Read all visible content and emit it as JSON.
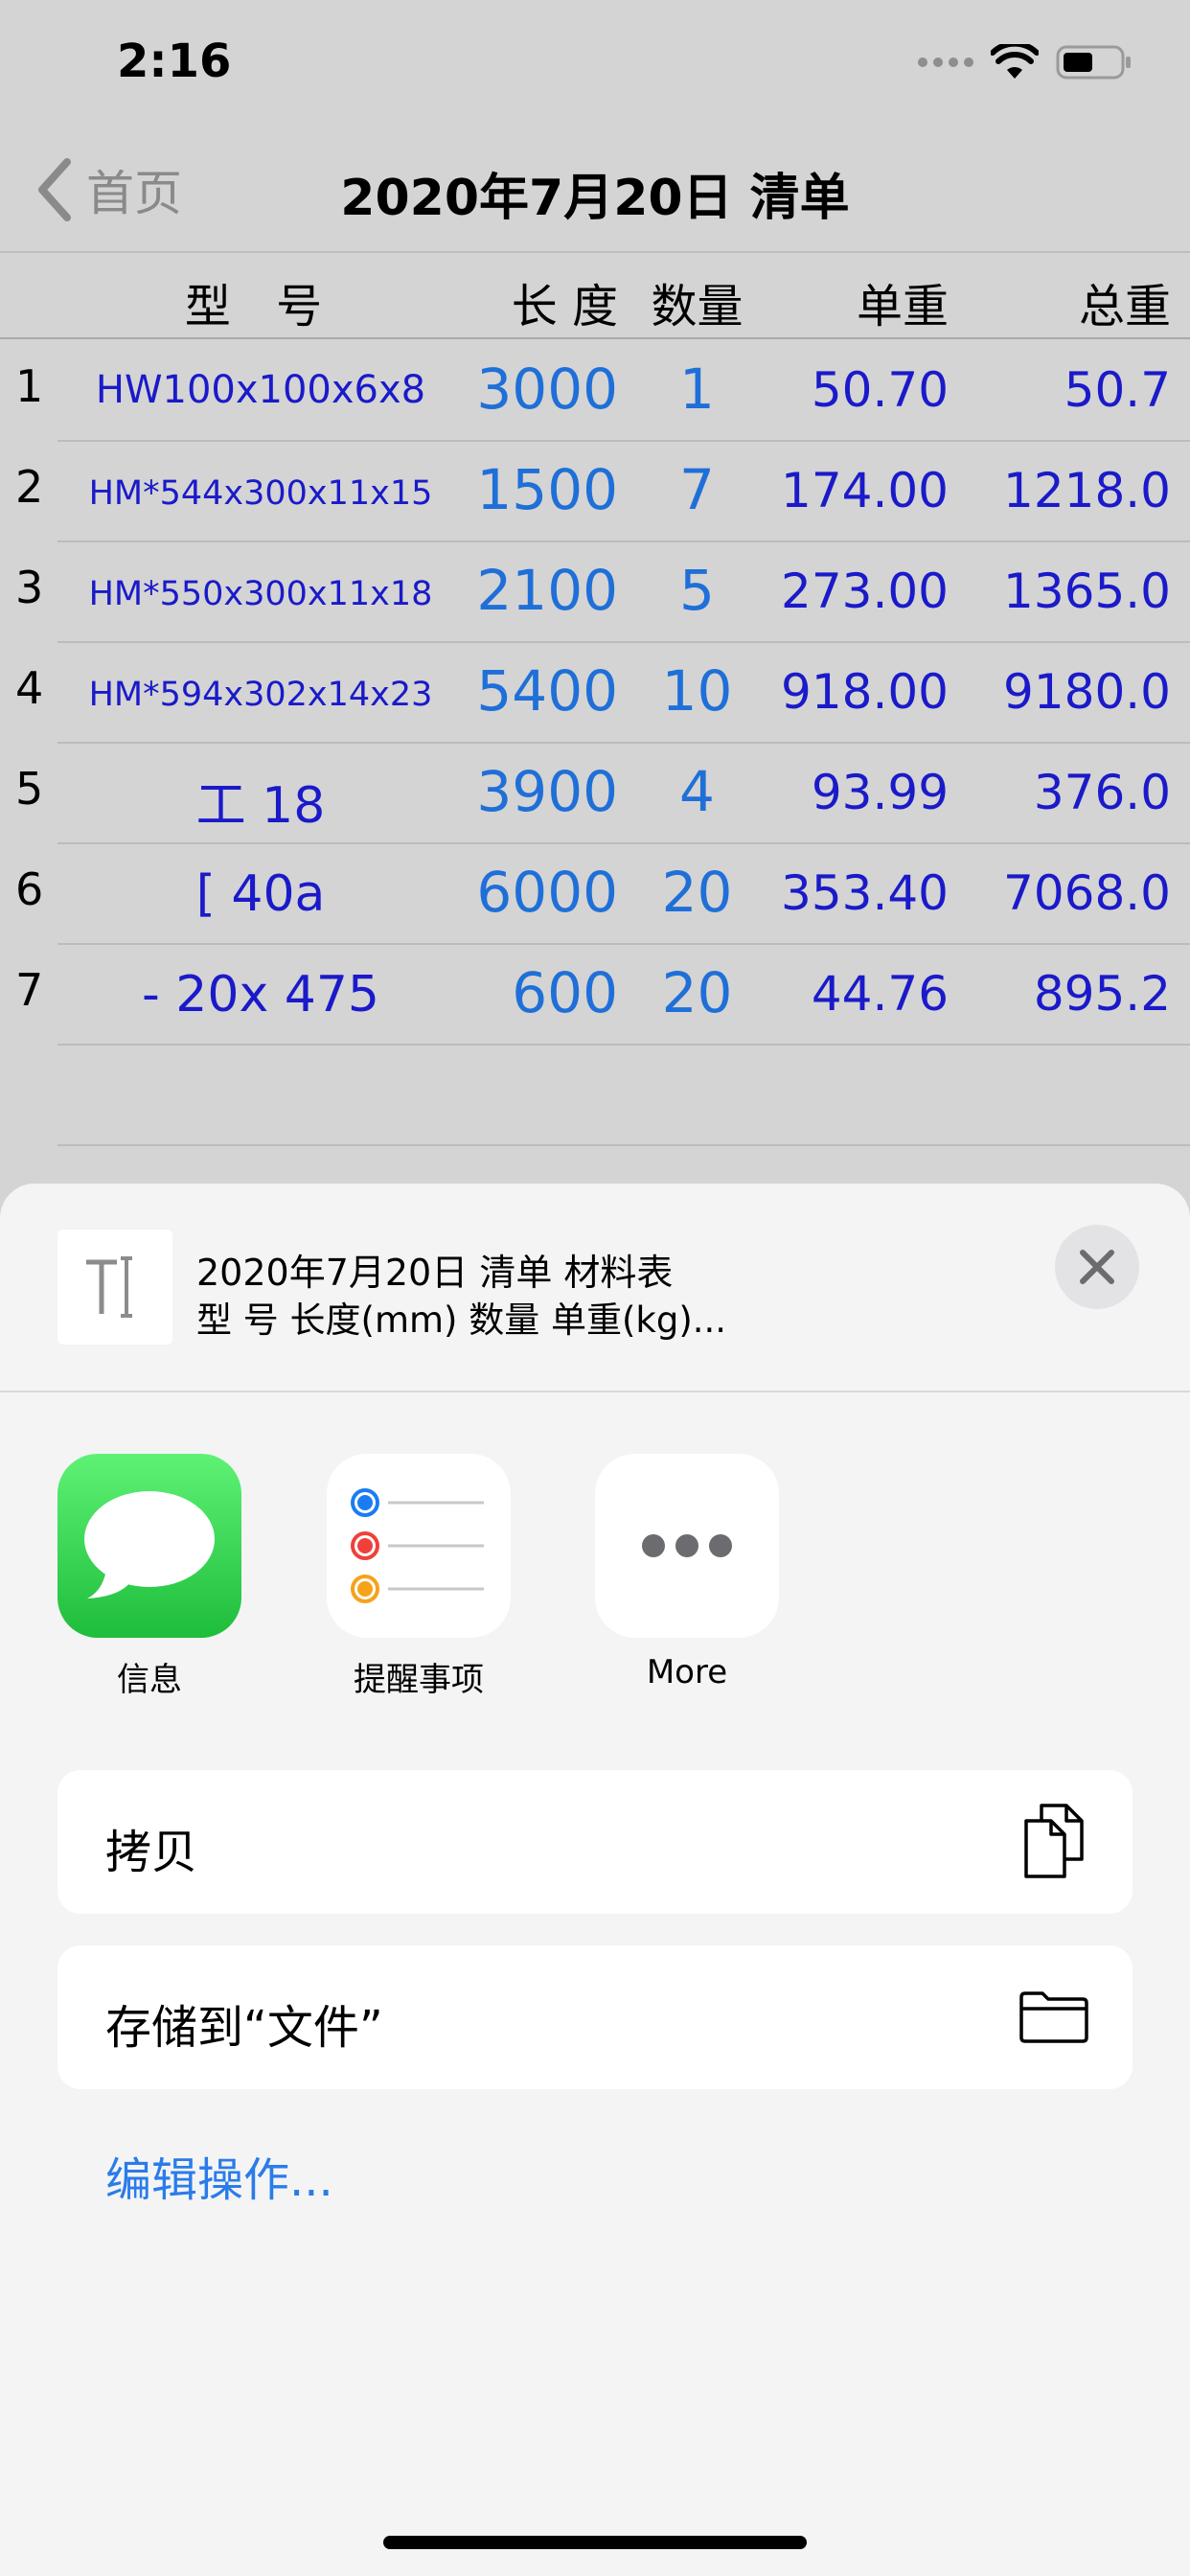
{
  "status_bar": {
    "time": "2:16",
    "icons": [
      "signal-icon",
      "wifi-icon",
      "battery-icon"
    ]
  },
  "nav": {
    "back_label": "首页",
    "title": "2020年7月20日 清单"
  },
  "table": {
    "headers": {
      "model": "型 号",
      "length": "长 度",
      "qty": "数量",
      "unit_weight": "单重",
      "total_weight": "总重"
    },
    "rows": [
      {
        "idx": "1",
        "model": "HW100x100x6x8",
        "length": "3000",
        "qty": "1",
        "unit": "50.70",
        "total": "50.7"
      },
      {
        "idx": "2",
        "model": "HM*544x300x11x15",
        "length": "1500",
        "qty": "7",
        "unit": "174.00",
        "total": "1218.0"
      },
      {
        "idx": "3",
        "model": "HM*550x300x11x18",
        "length": "2100",
        "qty": "5",
        "unit": "273.00",
        "total": "1365.0"
      },
      {
        "idx": "4",
        "model": "HM*594x302x14x23",
        "length": "5400",
        "qty": "10",
        "unit": "918.00",
        "total": "9180.0"
      },
      {
        "idx": "5",
        "model": "工  18",
        "length": "3900",
        "qty": "4",
        "unit": "93.99",
        "total": "376.0"
      },
      {
        "idx": "6",
        "model": "[  40a",
        "length": "6000",
        "qty": "20",
        "unit": "353.40",
        "total": "7068.0"
      },
      {
        "idx": "7",
        "model": "- 20x 475",
        "length": "600",
        "qty": "20",
        "unit": "44.76",
        "total": "895.2"
      }
    ]
  },
  "share_sheet": {
    "preview_line1": "2020年7月20日 清单   材料表",
    "preview_line2": "      型  号       长度(mm)     数量     单重(kg)...",
    "apps": [
      {
        "label": "信息",
        "icon": "messages-icon"
      },
      {
        "label": "提醒事项",
        "icon": "reminders-icon"
      },
      {
        "label": "More",
        "icon": "more-icon"
      }
    ],
    "actions": [
      {
        "label": "拷贝",
        "icon": "copy-icon"
      },
      {
        "label": "存储到“文件”",
        "icon": "folder-icon"
      }
    ],
    "edit_actions": "编辑操作...",
    "colors": {
      "accent": "#2a7ce9",
      "table_text": "#1a1aca",
      "table_highlight": "#1f6fd8",
      "messages_green": "#1ebd3b"
    }
  }
}
